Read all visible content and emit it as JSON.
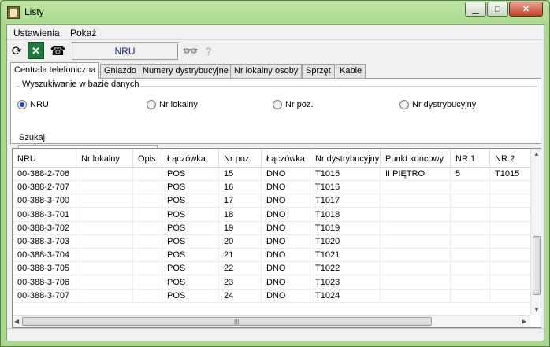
{
  "window": {
    "title": "Listy"
  },
  "menu": {
    "settings": "Ustawienia",
    "show": "Pokaż"
  },
  "toolbar": {
    "nru_label": "NRU"
  },
  "tabs": [
    "Centrala telefoniczna",
    "Gniazdo",
    "Numery dystrybucyjne",
    "Nr lokalny osoby",
    "Sprzęt",
    "Kable"
  ],
  "search": {
    "group_label": "Wyszukiwanie w bazie danych",
    "options": [
      "NRU",
      "Nr lokalny",
      "Nr poz.",
      "Nr dystrybucyjny"
    ],
    "selected": "NRU",
    "search_label": "Szukaj",
    "value": ""
  },
  "table": {
    "columns": [
      "NRU",
      "Nr lokalny",
      "Opis",
      "Łączówka",
      "Nr poz.",
      "Łączówka",
      "Nr dystrybucyjny",
      "Punkt końcowy",
      "NR 1",
      "NR 2"
    ],
    "rows": [
      [
        "00-388-2-706",
        "",
        "",
        "POS",
        "15",
        "DNO",
        "T1015",
        "II PIĘTRO",
        "5",
        "T1015"
      ],
      [
        "00-388-2-707",
        "",
        "",
        "POS",
        "16",
        "DNO",
        "T1016",
        "",
        "",
        ""
      ],
      [
        "00-388-3-700",
        "",
        "",
        "POS",
        "17",
        "DNO",
        "T1017",
        "",
        "",
        ""
      ],
      [
        "00-388-3-701",
        "",
        "",
        "POS",
        "18",
        "DNO",
        "T1018",
        "",
        "",
        ""
      ],
      [
        "00-388-3-702",
        "",
        "",
        "POS",
        "19",
        "DNO",
        "T1019",
        "",
        "",
        ""
      ],
      [
        "00-388-3-703",
        "",
        "",
        "POS",
        "20",
        "DNO",
        "T1020",
        "",
        "",
        ""
      ],
      [
        "00-388-3-704",
        "",
        "",
        "POS",
        "21",
        "DNO",
        "T1021",
        "",
        "",
        ""
      ],
      [
        "00-388-3-705",
        "",
        "",
        "POS",
        "22",
        "DNO",
        "T1022",
        "",
        "",
        ""
      ],
      [
        "00-388-3-706",
        "",
        "",
        "POS",
        "23",
        "DNO",
        "T1023",
        "",
        "",
        ""
      ],
      [
        "00-388-3-707",
        "",
        "",
        "POS",
        "24",
        "DNO",
        "T1024",
        "",
        "",
        ""
      ]
    ]
  },
  "icons": {
    "app": "list-app-icon",
    "refresh": "refresh-icon",
    "excel": "excel-export-icon",
    "phone": "phone-icon",
    "find": "binoculars-icon",
    "help": "help-icon"
  },
  "colors": {
    "accent": "#1a50c0",
    "titlebar": "#a9d98e",
    "nru_text": "#1a2a8a"
  }
}
